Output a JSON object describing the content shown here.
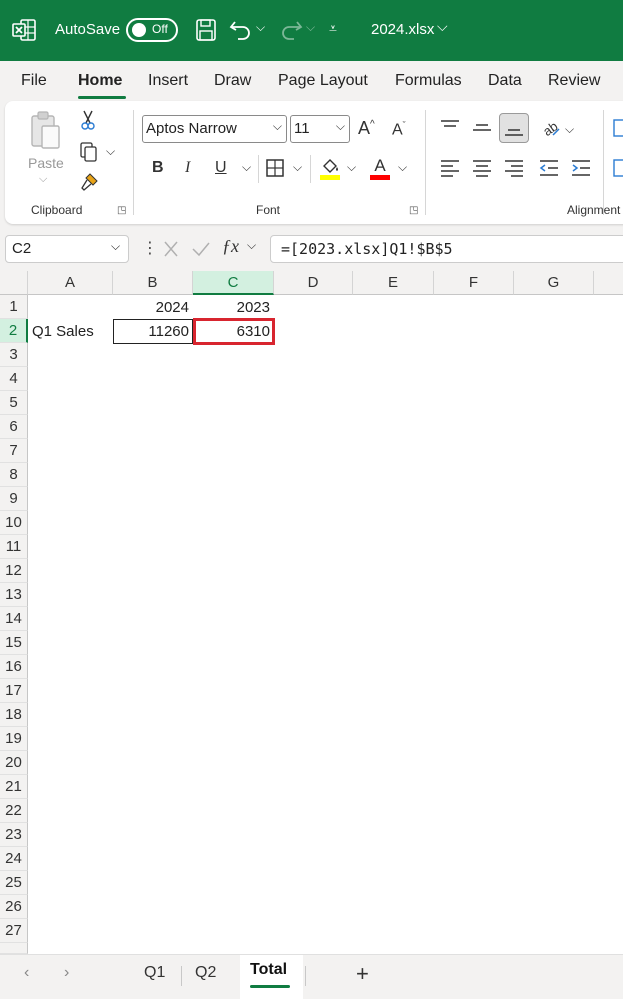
{
  "titlebar": {
    "autosave_label": "AutoSave",
    "autosave_state": "Off",
    "filename": "2024.xlsx",
    "chevron": "⌵"
  },
  "menu": {
    "items": [
      "File",
      "Home",
      "Insert",
      "Draw",
      "Page Layout",
      "Formulas",
      "Data",
      "Review"
    ],
    "active": "Home"
  },
  "ribbon": {
    "clipboard": {
      "group_label": "Clipboard",
      "paste_label": "Paste"
    },
    "font": {
      "group_label": "Font",
      "font_name": "Aptos Narrow",
      "font_size": "11"
    },
    "alignment": {
      "group_label": "Alignment"
    },
    "colors": {
      "highlight": "#ffff00",
      "font_color": "#ff0000",
      "accent": "#107c41"
    }
  },
  "formula_bar": {
    "name_box": "C2",
    "formula": "=[2023.xlsx]Q1!$B$5"
  },
  "grid": {
    "columns": [
      "A",
      "B",
      "C",
      "D",
      "E",
      "F",
      "G"
    ],
    "selected_column": "C",
    "rows": [
      "1",
      "2",
      "3",
      "4",
      "5",
      "6",
      "7",
      "8",
      "9",
      "10",
      "11",
      "12",
      "13",
      "14",
      "15",
      "16",
      "17",
      "18",
      "19",
      "20",
      "21",
      "22",
      "23",
      "24",
      "25",
      "26",
      "27"
    ],
    "selected_row": "2",
    "cells": {
      "B1": "2024",
      "C1": "2023",
      "A2": "Q1 Sales",
      "B2": "11260",
      "C2": "6310"
    }
  },
  "sheet_tabs": {
    "tabs": [
      "Q1",
      "Q2",
      "Total"
    ],
    "active": "Total",
    "add_label": "+"
  }
}
